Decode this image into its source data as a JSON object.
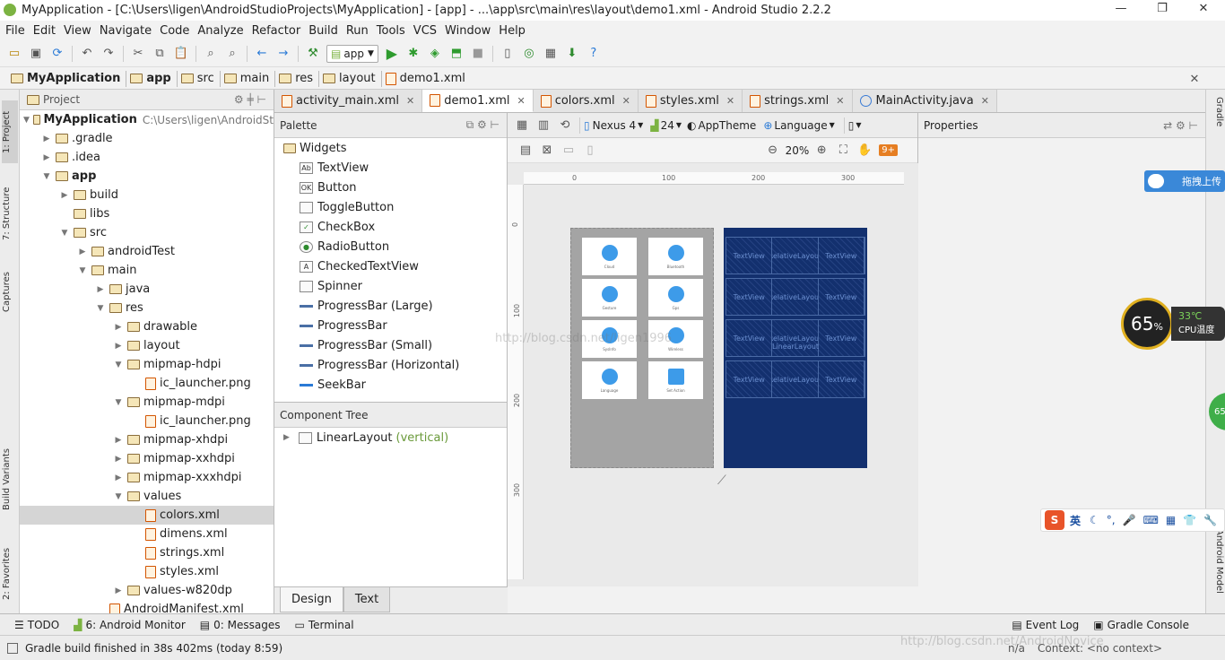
{
  "window": {
    "title": "MyApplication - [C:\\Users\\ligen\\AndroidStudioProjects\\MyApplication] - [app] - ...\\app\\src\\main\\res\\layout\\demo1.xml - Android Studio 2.2.2"
  },
  "menu": [
    "File",
    "Edit",
    "View",
    "Navigate",
    "Code",
    "Analyze",
    "Refactor",
    "Build",
    "Run",
    "Tools",
    "VCS",
    "Window",
    "Help"
  ],
  "toolbar": {
    "run_config": "app"
  },
  "breadcrumb": [
    "MyApplication",
    "app",
    "src",
    "main",
    "res",
    "layout",
    "demo1.xml"
  ],
  "left_tool_tabs": [
    "1: Project",
    "7: Structure",
    "Captures",
    "Build Variants",
    "2: Favorites"
  ],
  "right_tool_tabs": [
    "Gradle",
    "Android Model"
  ],
  "project_panel": {
    "title": "Project",
    "root_label": "MyApplication",
    "root_path": "C:\\Users\\ligen\\AndroidSt",
    "items": [
      {
        "label": ".gradle",
        "depth": 1,
        "expander": "collapsed",
        "icon": "folder"
      },
      {
        "label": ".idea",
        "depth": 1,
        "expander": "collapsed",
        "icon": "folder"
      },
      {
        "label": "app",
        "depth": 1,
        "expander": "expanded",
        "icon": "folder",
        "bold": true
      },
      {
        "label": "build",
        "depth": 2,
        "expander": "collapsed",
        "icon": "folder"
      },
      {
        "label": "libs",
        "depth": 2,
        "expander": "none",
        "icon": "folder"
      },
      {
        "label": "src",
        "depth": 2,
        "expander": "expanded",
        "icon": "folder"
      },
      {
        "label": "androidTest",
        "depth": 3,
        "expander": "collapsed",
        "icon": "folder"
      },
      {
        "label": "main",
        "depth": 3,
        "expander": "expanded",
        "icon": "folder"
      },
      {
        "label": "java",
        "depth": 4,
        "expander": "collapsed",
        "icon": "folder"
      },
      {
        "label": "res",
        "depth": 4,
        "expander": "expanded",
        "icon": "folder"
      },
      {
        "label": "drawable",
        "depth": 5,
        "expander": "collapsed",
        "icon": "folder"
      },
      {
        "label": "layout",
        "depth": 5,
        "expander": "collapsed",
        "icon": "folder"
      },
      {
        "label": "mipmap-hdpi",
        "depth": 5,
        "expander": "expanded",
        "icon": "folder"
      },
      {
        "label": "ic_launcher.png",
        "depth": 6,
        "expander": "none",
        "icon": "file"
      },
      {
        "label": "mipmap-mdpi",
        "depth": 5,
        "expander": "expanded",
        "icon": "folder"
      },
      {
        "label": "ic_launcher.png",
        "depth": 6,
        "expander": "none",
        "icon": "file"
      },
      {
        "label": "mipmap-xhdpi",
        "depth": 5,
        "expander": "collapsed",
        "icon": "folder"
      },
      {
        "label": "mipmap-xxhdpi",
        "depth": 5,
        "expander": "collapsed",
        "icon": "folder"
      },
      {
        "label": "mipmap-xxxhdpi",
        "depth": 5,
        "expander": "collapsed",
        "icon": "folder"
      },
      {
        "label": "values",
        "depth": 5,
        "expander": "expanded",
        "icon": "folder"
      },
      {
        "label": "colors.xml",
        "depth": 6,
        "expander": "none",
        "icon": "file",
        "selected": true
      },
      {
        "label": "dimens.xml",
        "depth": 6,
        "expander": "none",
        "icon": "file"
      },
      {
        "label": "strings.xml",
        "depth": 6,
        "expander": "none",
        "icon": "file"
      },
      {
        "label": "styles.xml",
        "depth": 6,
        "expander": "none",
        "icon": "file"
      },
      {
        "label": "values-w820dp",
        "depth": 5,
        "expander": "collapsed",
        "icon": "folder"
      },
      {
        "label": "AndroidManifest.xml",
        "depth": 4,
        "expander": "none",
        "icon": "file"
      }
    ]
  },
  "editor_tabs": [
    {
      "label": "activity_main.xml",
      "active": false
    },
    {
      "label": "demo1.xml",
      "active": true
    },
    {
      "label": "colors.xml",
      "active": false
    },
    {
      "label": "styles.xml",
      "active": false
    },
    {
      "label": "strings.xml",
      "active": false
    },
    {
      "label": "MainActivity.java",
      "active": false
    }
  ],
  "palette": {
    "title": "Palette",
    "group": "Widgets",
    "items": [
      {
        "label": "TextView",
        "icon": "Ab"
      },
      {
        "label": "Button",
        "icon": "OK"
      },
      {
        "label": "ToggleButton",
        "icon": ""
      },
      {
        "label": "CheckBox",
        "icon": "check"
      },
      {
        "label": "RadioButton",
        "icon": "radio"
      },
      {
        "label": "CheckedTextView",
        "icon": "A"
      },
      {
        "label": "Spinner",
        "icon": ""
      },
      {
        "label": "ProgressBar (Large)",
        "icon": "bar"
      },
      {
        "label": "ProgressBar",
        "icon": "bar"
      },
      {
        "label": "ProgressBar (Small)",
        "icon": "bar"
      },
      {
        "label": "ProgressBar (Horizontal)",
        "icon": "bar"
      },
      {
        "label": "SeekBar",
        "icon": "seek"
      }
    ]
  },
  "component_tree": {
    "title": "Component Tree",
    "root": "LinearLayout",
    "root_hint": "(vertical)"
  },
  "design_tabs": [
    {
      "label": "Design",
      "active": true
    },
    {
      "label": "Text",
      "active": false
    }
  ],
  "designer": {
    "device": "Nexus 4",
    "api": "24",
    "theme": "AppTheme",
    "language": "Language",
    "zoom": "20%",
    "zoom_badge": "9+",
    "ruler_h": [
      "0",
      "100",
      "200",
      "300"
    ],
    "ruler_v": [
      "0",
      "100",
      "200",
      "300"
    ],
    "tiles": [
      "Cloud",
      "Bluetooth",
      "Gesture",
      "Gps",
      "SysInfo",
      "Wireless",
      "Language",
      "Set Action"
    ],
    "blueprint_rows": [
      [
        "TextView",
        "RelativeLayout",
        "TextView"
      ],
      [
        "TextView",
        "RelativeLayout",
        "TextView"
      ],
      [
        "TextView",
        "RelativeLayout",
        "TextView"
      ],
      [
        "TextView",
        "RelativeLayout",
        "TextView"
      ]
    ],
    "blueprint_label": "LinearLayout"
  },
  "properties": {
    "title": "Properties"
  },
  "bottom_tabs": [
    "TODO",
    "6: Android Monitor",
    "0: Messages",
    "Terminal"
  ],
  "bottom_right_tabs": [
    "Event Log",
    "Gradle Console"
  ],
  "status": {
    "message": "Gradle build finished in 38s 402ms (today 8:59)",
    "right": "n/a",
    "context": "Context: <no context>"
  },
  "overlays": {
    "upload_label": "拖拽上传",
    "cpu_percent": "65",
    "cpu_percent_sign": "%",
    "cpu_temp": "33℃",
    "cpu_temp_label": "CPU温度",
    "ime_mode": "英",
    "side_badge": "65",
    "watermark": "http://blog.csdn.net/ligen1996",
    "watermark2": "http://blog.csdn.net/AndroidNovice"
  }
}
